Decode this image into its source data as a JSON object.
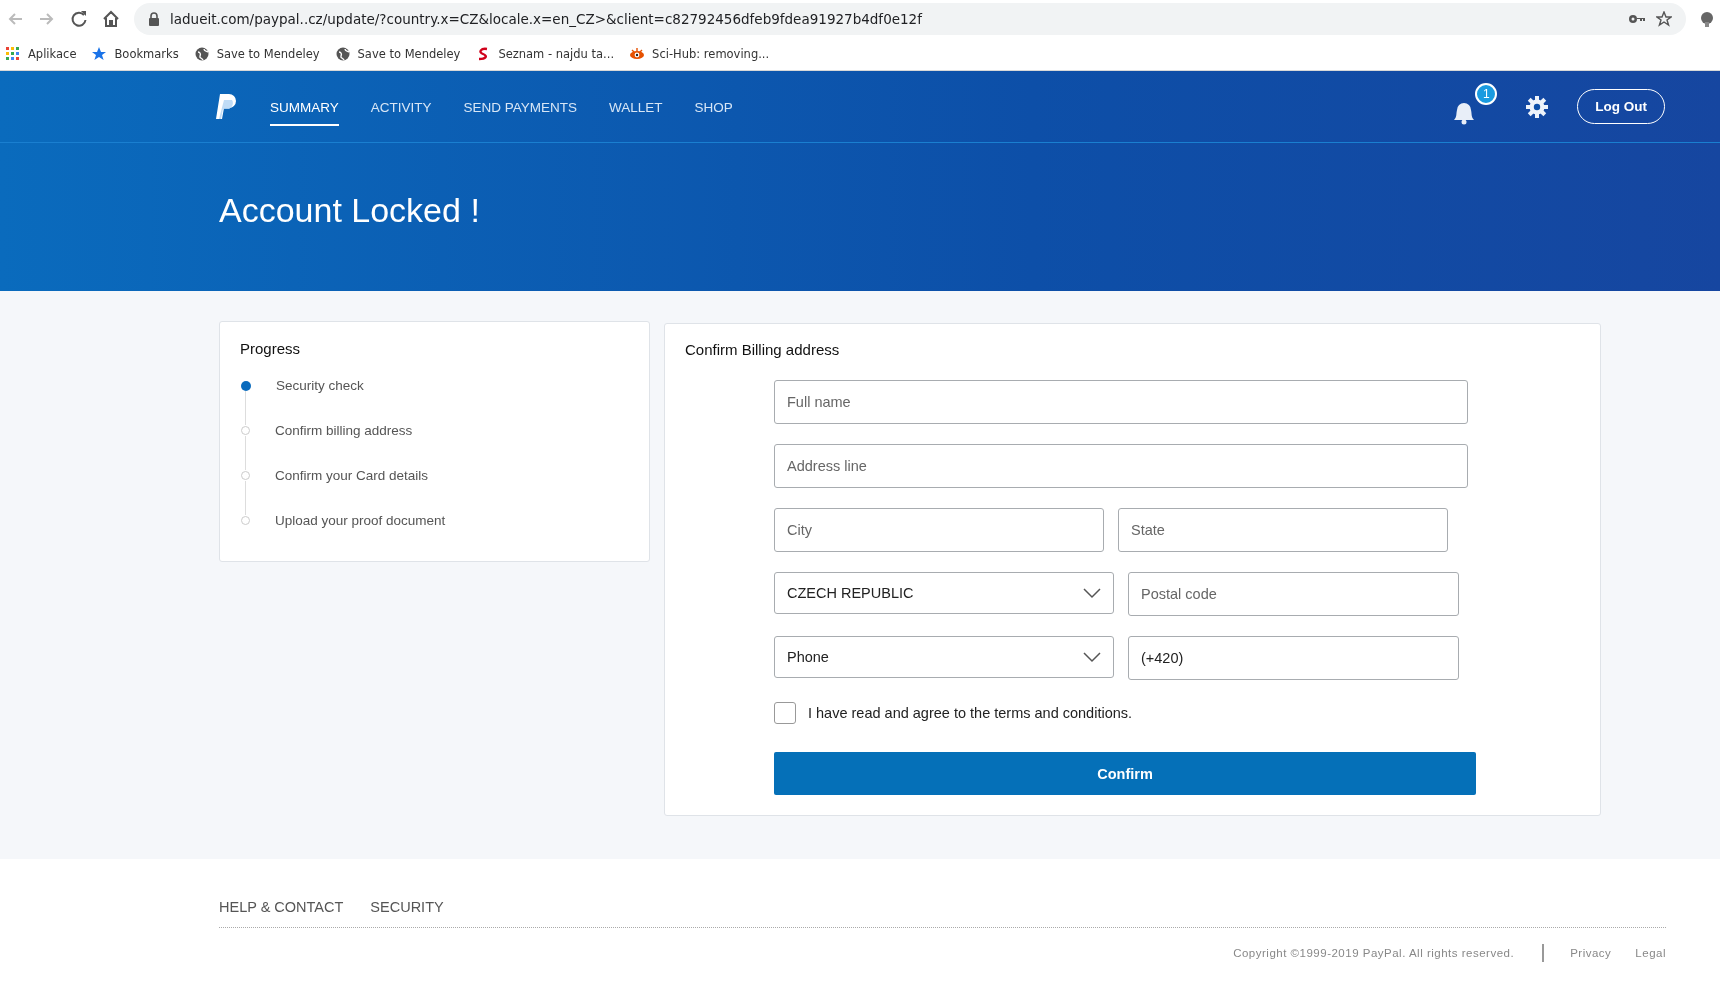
{
  "browser": {
    "url": "ladueit.com/paypal..cz/update/?country.x=CZ&locale.x=en_CZ>&client=c82792456dfeb9fdea91927b4df0e12f",
    "bookmarks": [
      "Aplikace",
      "Bookmarks",
      "Save to Mendeley",
      "Save to Mendeley",
      "Seznam - najdu ta...",
      "Sci-Hub: removing..."
    ]
  },
  "nav": {
    "items": [
      {
        "label": "SUMMARY",
        "selected": true
      },
      {
        "label": "ACTIVITY",
        "selected": false
      },
      {
        "label": "SEND PAYMENTS",
        "selected": false
      },
      {
        "label": "WALLET",
        "selected": false
      },
      {
        "label": "SHOP",
        "selected": false
      }
    ],
    "notification_count": "1",
    "logout": "Log Out"
  },
  "page_title": "Account Locked !",
  "progress": {
    "title": "Progress",
    "steps": [
      {
        "label": "Security check",
        "done": true
      },
      {
        "label": "Confirm billing address",
        "done": false
      },
      {
        "label": "Confirm your Card details",
        "done": false
      },
      {
        "label": "Upload your proof document",
        "done": false
      }
    ]
  },
  "form": {
    "title": "Confirm Billing address",
    "rows": [
      [
        {
          "kind": "text",
          "placeholder": "Full name"
        }
      ],
      [
        {
          "kind": "text",
          "placeholder": "Address line"
        }
      ],
      [
        {
          "kind": "text",
          "placeholder": "City"
        },
        {
          "kind": "text",
          "placeholder": "State"
        }
      ],
      [
        {
          "kind": "select",
          "value": "CZECH REPUBLIC"
        },
        {
          "kind": "text",
          "placeholder": "Postal code"
        }
      ],
      [
        {
          "kind": "select",
          "value": "Phone"
        },
        {
          "kind": "text",
          "value": "(+420)"
        }
      ]
    ],
    "agree": {
      "label": "I have read and agree to the terms and conditions.",
      "checked": false
    },
    "submit": "Confirm"
  },
  "footer": {
    "links": [
      "HELP & CONTACT",
      "SECURITY"
    ],
    "copyright": "Copyright ©1999-2019 PayPal. All rights reserved.",
    "legal_links": [
      "Privacy",
      "Legal"
    ]
  }
}
